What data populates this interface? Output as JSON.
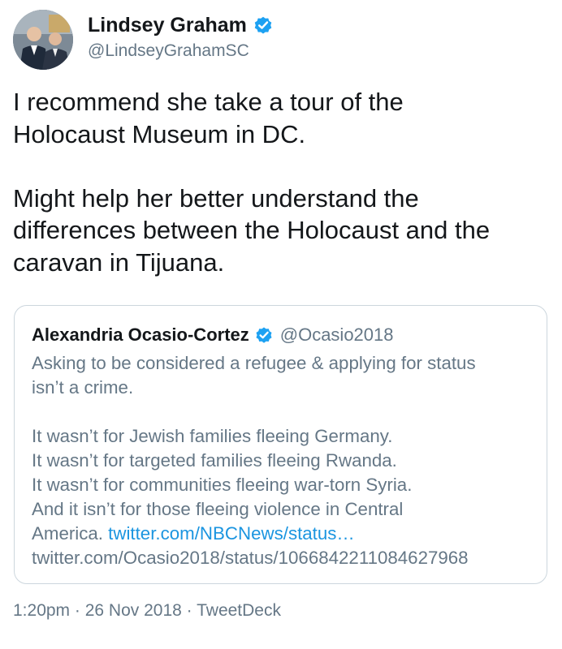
{
  "author": {
    "display_name": "Lindsey Graham",
    "handle": "@LindseyGrahamSC",
    "verified": true
  },
  "tweet": {
    "paragraphs": [
      [
        "I recommend she take a tour of the",
        "Holocaust Museum in DC."
      ],
      [
        "Might help her better understand the",
        "differences between the Holocaust and the",
        "caravan in Tijuana."
      ]
    ]
  },
  "quoted_tweet": {
    "display_name": "Alexandria Ocasio-Cortez",
    "handle": "@Ocasio2018",
    "verified": true,
    "lines": [
      "Asking to be considered a refugee & applying for status",
      "isn’t a crime.",
      "",
      "It wasn’t for Jewish families fleeing Germany.",
      "It wasn’t for targeted families fleeing Rwanda.",
      "It wasn’t for communities fleeing war-torn Syria.",
      "And it isn’t for those fleeing violence in Central"
    ],
    "last_line_prefix": "America. ",
    "link_text": "twitter.com/NBCNews/status…",
    "url_text": "twitter.com/Ocasio2018/status/1066842211084627968"
  },
  "meta": {
    "time": "1:20pm",
    "separator": " · ",
    "date": "26 Nov 2018",
    "source": "TweetDeck"
  },
  "colors": {
    "verified_badge": "#1da1f2",
    "link": "#1b95e0",
    "secondary_text": "#657786",
    "primary_text": "#14171a",
    "quote_border": "#ccd6dd"
  },
  "icons": {
    "avatar": "profile-photo",
    "verified": "verified-badge-icon"
  }
}
